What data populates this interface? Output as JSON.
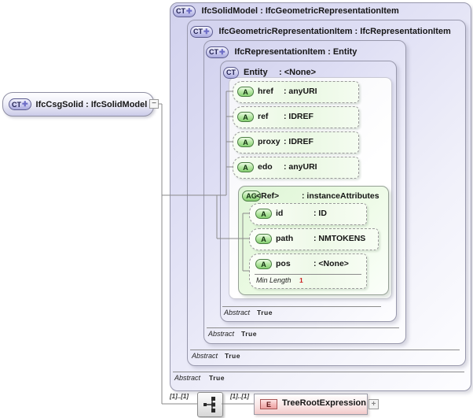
{
  "icons": {
    "ct": "CT",
    "plus": "✚",
    "a": "A",
    "ag": "AG",
    "e": "E",
    "collapse": "−",
    "expand": "+"
  },
  "root_node": {
    "label": "IfcCsgSolid : IfcSolidModel"
  },
  "boxes": [
    {
      "label": "IfcSolidModel : IfcGeometricRepresentationItem",
      "facet": {
        "name": "Abstract",
        "value": "True"
      }
    },
    {
      "label": "IfcGeometricRepresentationItem : IfcRepresentationItem",
      "facet": {
        "name": "Abstract",
        "value": "True"
      }
    },
    {
      "label": "IfcRepresentationItem : Entity",
      "facet": {
        "name": "Abstract",
        "value": "True"
      }
    },
    {
      "name": "Entity",
      "type": ": <None>",
      "facet": {
        "name": "Abstract",
        "value": "True"
      }
    }
  ],
  "attributes": [
    {
      "name": "href",
      "type": ": anyURI"
    },
    {
      "name": "ref",
      "type": ": IDREF"
    },
    {
      "name": "proxy",
      "type": ": IDREF"
    },
    {
      "name": "edo",
      "type": ": anyURI"
    }
  ],
  "attribute_group": {
    "name": "<Ref>",
    "type": ": instanceAttributes",
    "attributes": [
      {
        "name": "id",
        "type": ": ID"
      },
      {
        "name": "path",
        "type": ": NMTOKENS"
      },
      {
        "name": "pos",
        "type": ": <None>",
        "facet": {
          "name": "Min Length",
          "value": "1"
        }
      }
    ]
  },
  "bottom": {
    "cardinality_left": "[1]..[1]",
    "cardinality_right": "[1]..[1]",
    "element": {
      "label": "TreeRootExpression"
    }
  }
}
